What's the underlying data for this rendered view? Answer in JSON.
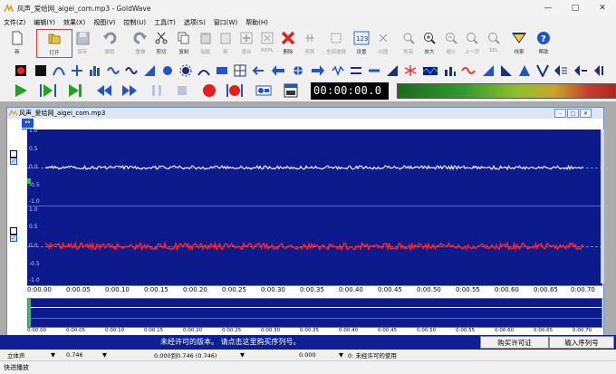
{
  "window": {
    "title": "风声_爱给网_aigei_com.mp3 - GoldWave",
    "controls": [
      "minimize-icon",
      "maximize-icon",
      "close-icon"
    ]
  },
  "menu": [
    "文件(Z)",
    "编辑(Y)",
    "效果(X)",
    "视图(V)",
    "控制(U)",
    "工具(T)",
    "选项(S)",
    "窗口(W)",
    "帮助(H)"
  ],
  "toolbar": {
    "new": "新",
    "open": "打开",
    "save": "保存",
    "undo": "撤销",
    "redo": "重做",
    "cut": "剪切",
    "copy": "复制",
    "paste": "粘贴",
    "new_paste": "新",
    "mix": "混合",
    "replace": "REPL",
    "delete": "删除",
    "trim": "修剪",
    "select_all": "全部选择",
    "settings": "设置",
    "fit": "以图",
    "all": "所有",
    "zoom_in": "放大",
    "zoom_out": "缩小",
    "prev": "上一页",
    "sel": "SEL",
    "cue": "线索",
    "help": "帮助"
  },
  "transport": {
    "time": "00:00:00.0"
  },
  "document": {
    "title": "风声_爱给网_aigei_com.mp3",
    "top_channel_ticks": [
      "1.0",
      "0.5",
      "0.0",
      "-0.5",
      "-1.0"
    ],
    "bottom_channel_ticks": [
      "1.0",
      "0.5",
      "0.0",
      "-0.5",
      "-1.0"
    ],
    "ruler": [
      "0:00.00",
      "0:00.05",
      "0:00.10",
      "0:00.15",
      "0:00.20",
      "0:00.25",
      "0:00.30",
      "0:00.35",
      "0:00.40",
      "0:00.45",
      "0:00.50",
      "0:00.55",
      "0:00.60",
      "0:00.65",
      "0:00.70"
    ],
    "ruler_small": [
      "0:00.00",
      "0:00.05",
      "0:00.10",
      "0:00.15",
      "0:00.20",
      "0:00.25",
      "0:00.30",
      "0:00.35",
      "0:00.40",
      "0:00.45",
      "0:00.50",
      "0:00.55",
      "0:00.60",
      "0:00.65",
      "0:00.70"
    ]
  },
  "notice": {
    "message": "未经许可的版本。 请点击这里购买序列号。",
    "buy_button": "购买许可证",
    "serial_button": "输入序列号"
  },
  "status": {
    "channel": "立体声",
    "length": "0.746",
    "selection": "0.000到0.746 (0.746)",
    "position": "0.000",
    "license": "0: 未经许可的使用"
  },
  "footer": "快进播放",
  "colors": {
    "wave_bg": "#0d1a8c",
    "left_wave": "#ffffff",
    "right_wave": "#ff2020",
    "notice_bar": "#0e1f8f"
  }
}
